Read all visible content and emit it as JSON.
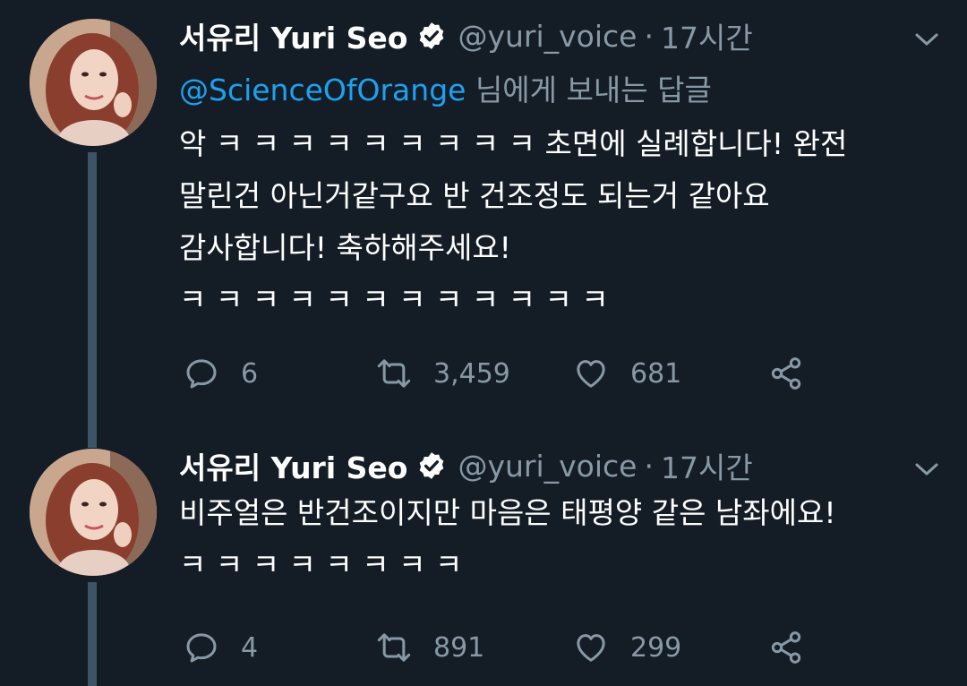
{
  "tweets": [
    {
      "author_name": "서유리 Yuri Seo",
      "handle": "@yuri_voice",
      "separator": "·",
      "time": "17시간",
      "reply_to_mention": "@ScienceOfOrange",
      "reply_to_suffix": " 님에게 보내는 답글",
      "lines": [
        "악 ㅋ ㅋ ㅋ ㅋ ㅋ ㅋ ㅋ ㅋ ㅋ 초면에 실례합니다! 완전",
        "말린건 아닌거같구요 반 건조정도 되는거 같아요",
        "감사합니다! 축하해주세요!",
        "ㅋ ㅋ ㅋ ㅋ ㅋ ㅋ ㅋ ㅋ ㅋ ㅋ ㅋ ㅋ"
      ],
      "replies": "6",
      "retweets": "3,459",
      "likes": "681"
    },
    {
      "author_name": "서유리 Yuri Seo",
      "handle": "@yuri_voice",
      "separator": "·",
      "time": "17시간",
      "lines": [
        "비주얼은 반건조이지만 마음은 태평양 같은 남좌에요!",
        "ㅋ ㅋ ㅋ ㅋ ㅋ ㅋ ㅋ ㅋ"
      ],
      "replies": "4",
      "retweets": "891",
      "likes": "299"
    }
  ],
  "icons": {
    "verified": "verified-badge-icon",
    "caret": "chevron-down-icon",
    "reply": "reply-icon",
    "retweet": "retweet-icon",
    "like": "heart-icon",
    "share": "share-icon"
  },
  "colors": {
    "background": "#141d26",
    "secondary_text": "#8899a6",
    "link": "#1da1f2",
    "thread_line": "#3d5466"
  }
}
